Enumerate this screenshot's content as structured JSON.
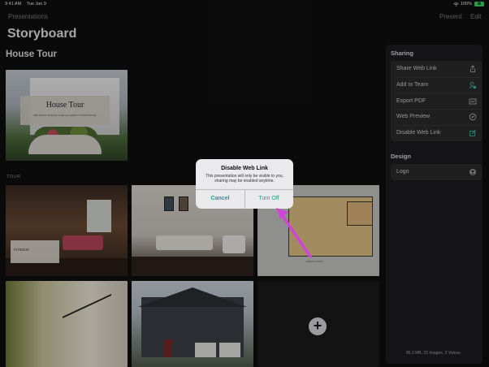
{
  "status": {
    "time": "9:41 AM",
    "date": "Tue Jan 9",
    "battery_text": "100%",
    "battery_badge": "Ⅲ"
  },
  "nav": {
    "back_label": "Presentations",
    "present_label": "Present",
    "edit_label": "Edit"
  },
  "page_title": "Storyboard",
  "section": {
    "title": "House Tour",
    "cover_title": "House Tour",
    "cover_subtitle": "BELMONT RIDGE SINGLE FAMILY PORTFOLIO",
    "group_label": "TOUR",
    "tile1_card_text": "INTERIOR",
    "floorplan_caption": "FIRST FLOOR"
  },
  "sharing": {
    "heading": "Sharing",
    "items": [
      {
        "label": "Share Web Link",
        "icon": "share-icon"
      },
      {
        "label": "Add to Team",
        "icon": "team-icon"
      },
      {
        "label": "Export PDF",
        "icon": "pdf-icon"
      },
      {
        "label": "Web Preview",
        "icon": "compass-icon"
      },
      {
        "label": "Disable Web Link",
        "icon": "disable-link-icon"
      }
    ]
  },
  "design": {
    "heading": "Design",
    "items": [
      {
        "label": "Logo",
        "icon": "logo-icon"
      }
    ]
  },
  "storage_summary": "85.2 MB, 23 Images, 3 Videos",
  "alert": {
    "title": "Disable Web Link",
    "message": "This presentation will only be visible to you, sharing may be enabled anytime.",
    "cancel_label": "Cancel",
    "confirm_label": "Turn Off"
  },
  "add_tile_symbol": "+",
  "colors": {
    "accent": "#1f9a8a",
    "annotation_arrow": "#d044d8",
    "background": "#0f0f10",
    "panel": "#1e1e20"
  }
}
